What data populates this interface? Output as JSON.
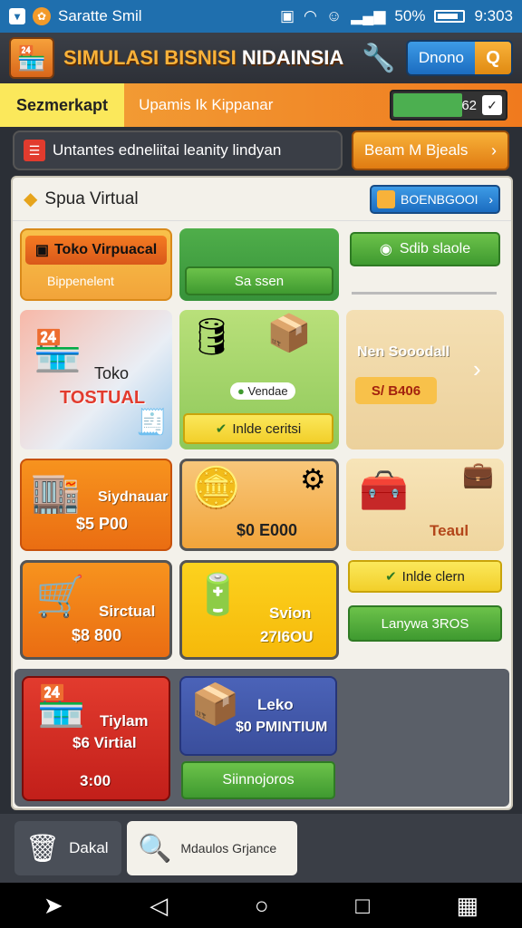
{
  "status": {
    "app_name": "Saratte Smil",
    "battery": "50%",
    "time": "9:303"
  },
  "header": {
    "title_orange": "SIMULASI BISNISI",
    "title_white": "NIDAINSIA",
    "button_label": "Dnono"
  },
  "strip": {
    "tab_label": "Sezmerkapt",
    "subtitle": "Upamis Ik Kippanar",
    "progress_value": "62",
    "progress_text": "62",
    "progress_fraction": 0.62
  },
  "notice": {
    "text": "Untantes edneliitai leanity lindyan",
    "button_label": "Beam M Bjeals"
  },
  "panel": {
    "title": "Spua Virtual",
    "button_label": "BOENBGOOI"
  },
  "cards": {
    "c1_title": "Toko Virpuacal",
    "c1_sub": "Bippenelent",
    "c2_pill": "Sa ssen",
    "c3_pill": "Sdib slaole",
    "c4_label1": "Toko",
    "c4_label2": "TOSTUAL",
    "c5_chip": "Vendae",
    "c5_pill": "Inlde ceritsi",
    "c6_title": "Nen Sooodall",
    "c6_price": "S/ B406",
    "c7_label1": "Siydnauar",
    "c7_label2": "$5 P00",
    "c8_label": "$0 E000",
    "c9_label": "Teaul",
    "c10_label1": "Sirctual",
    "c10_label2": "$8 800",
    "c11_label1": "Svion",
    "c11_label2": "27I6OU",
    "c12_pill1": "Inlde clern",
    "c12_pill2": "Lanywa 3ROS",
    "c13_label1": "Tiylam",
    "c13_label2": "$6 Virtial",
    "c13_label3": "3:00",
    "c14_label1": "Leko",
    "c14_label2": "$0 PMINTIUM",
    "c14_pill": "Siinnojoros"
  },
  "bottom_tabs": {
    "tab1": "Dakal",
    "tab2": "Mdaulos Grjance"
  }
}
